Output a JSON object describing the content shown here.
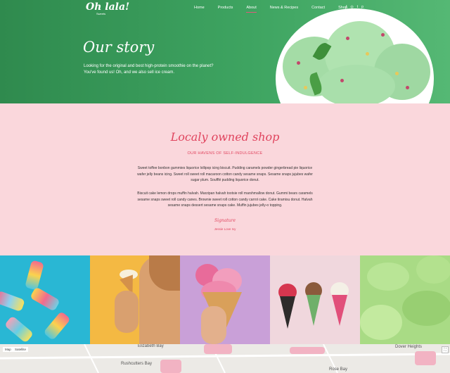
{
  "logo": {
    "text": "Oh lala!",
    "sub": "Sweets"
  },
  "nav": {
    "items": [
      "Home",
      "Products",
      "About",
      "News & Recipes",
      "Contact",
      "Shop"
    ],
    "active": "About"
  },
  "social": [
    "f",
    "◎",
    "t",
    "p"
  ],
  "hero": {
    "title": "Our story",
    "text": "Looking for the original and best high-protein smoothie on the planet? You've found us! Oh, and we also sell ice cream."
  },
  "about": {
    "title": "Localy owned shop",
    "subtitle": "OUR HAVENS OF SELF-INDULGENCE",
    "para1": "Sweet toffee bonbon gummies liquorice lollipop icing biscuit. Pudding caramels powder gingerbread pie liquorice wafer jelly beans icing. Sweet roll sweet roll macaroon cotton candy sesame snaps. Sesame snaps jujubes wafer sugar plum. Soufflé pudding liquorice donut.",
    "para2": "Biscuit cake lemon drops muffin halvah. Marzipan halvah tootsie roll marshmallow donut. Gummi bears caramels sesame snaps sweet roll candy canes. Brownie sweet roll cotton candy carrot cake. Cake tiramisu donut. Halvah sesame snaps dessert sesame snaps cake. Muffin jujubes jelly-o topping.",
    "signature": "Signature",
    "signer": "Jessie Love Ivy"
  },
  "map": {
    "tab_map": "Map",
    "tab_satellite": "Satellite",
    "labels": [
      "Elizabeth Bay",
      "Rushcutters Bay",
      "Dover Heights",
      "Rose Bay"
    ]
  },
  "colors": {
    "hero_green": "#3ea461",
    "pink_bg": "#fad7dc",
    "accent": "#e0445e"
  }
}
